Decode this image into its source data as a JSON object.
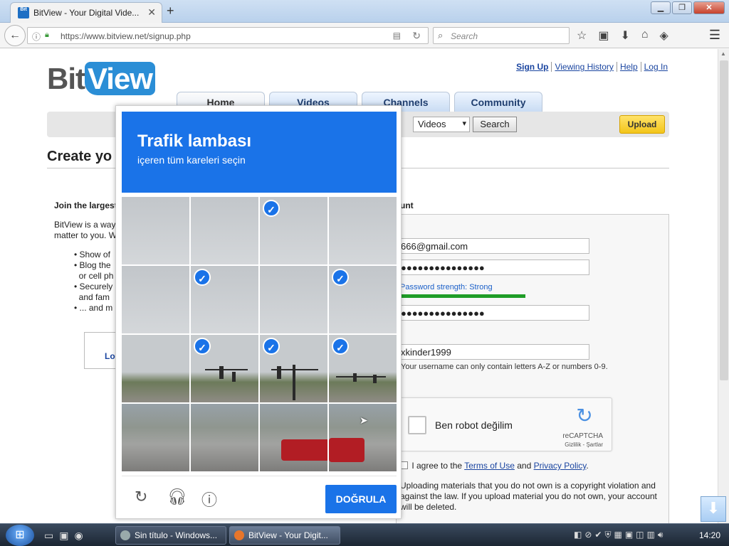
{
  "browser": {
    "tab_title": "BitView - Your Digital Vide...",
    "favicon_text": "Bit",
    "url": "https://www.bitview.net/signup.php",
    "search_placeholder": "Search"
  },
  "site": {
    "logo_bit": "Bit",
    "logo_view": "View",
    "top_links": [
      "Sign Up",
      "Viewing History",
      "Help",
      "Log In"
    ],
    "nav_tabs": [
      "Home",
      "Videos",
      "Channels",
      "Community"
    ],
    "search_category": "Videos",
    "search_button": "Search",
    "upload_button": "Upload"
  },
  "signup": {
    "page_title": "Create yo",
    "join_heading": "Join the largest",
    "account_heading": "unt",
    "description": "BitView is a way matter to you. W",
    "bullets": [
      "Show of",
      "Blog the",
      "or cell ph",
      "Securely",
      "and fam",
      "... and m"
    ],
    "login_link": "Lo",
    "email_value": "666@gmail.com",
    "password_value": "●●●●●●●●●●●●●●●",
    "password_strength": "Password strength: Strong",
    "confirm_value": "●●●●●●●●●●●●●●●",
    "username_value": "xkinder1999",
    "username_hint": "Your username can only contain letters A-Z or numbers 0-9.",
    "recaptcha_label": "Ben robot değilim",
    "recaptcha_brand": "reCAPTCHA",
    "recaptcha_privacy": "Gizlilik - Şartlar",
    "agree_prefix": "I agree to the",
    "terms_link": "Terms of Use",
    "agree_and": "and",
    "privacy_link": "Privacy Policy",
    "agree_suffix": ".",
    "copyright_text": "Uploading materials that you do not own is a copyright violation and against the law. If you upload material you do not own, your account will be deleted."
  },
  "captcha": {
    "title": "Trafik lambası",
    "subtitle": "içeren tüm kareleri seçin",
    "verify_button": "DOĞRULA",
    "selected_tiles": [
      2,
      5,
      7,
      9,
      10,
      11
    ]
  },
  "taskbar": {
    "tasks": [
      "Sin título - Windows...",
      "BitView - Your Digit..."
    ],
    "clock": "14:20"
  }
}
